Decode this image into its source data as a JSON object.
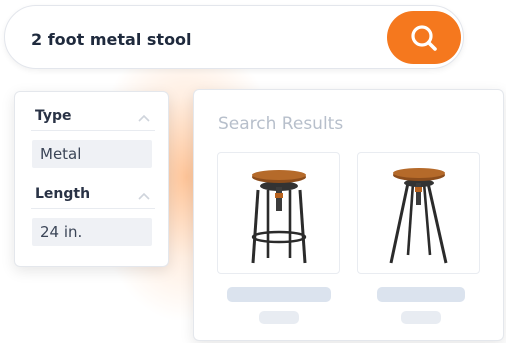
{
  "search": {
    "query": "2 foot metal stool",
    "button_icon": "search-icon"
  },
  "filters": {
    "type": {
      "heading": "Type",
      "value": "Metal"
    },
    "length": {
      "heading": "Length",
      "value": "24 in."
    }
  },
  "results": {
    "title": "Search Results",
    "products": [
      {
        "image": "stool-with-footring-image"
      },
      {
        "image": "stool-four-legs-image"
      }
    ]
  },
  "colors": {
    "accent": "#f5781e",
    "skeleton_bar": "#dbe3ee",
    "skeleton_pill": "#e8ecf2",
    "heading_text": "#2a3346",
    "muted_text": "#b7bfcb"
  }
}
